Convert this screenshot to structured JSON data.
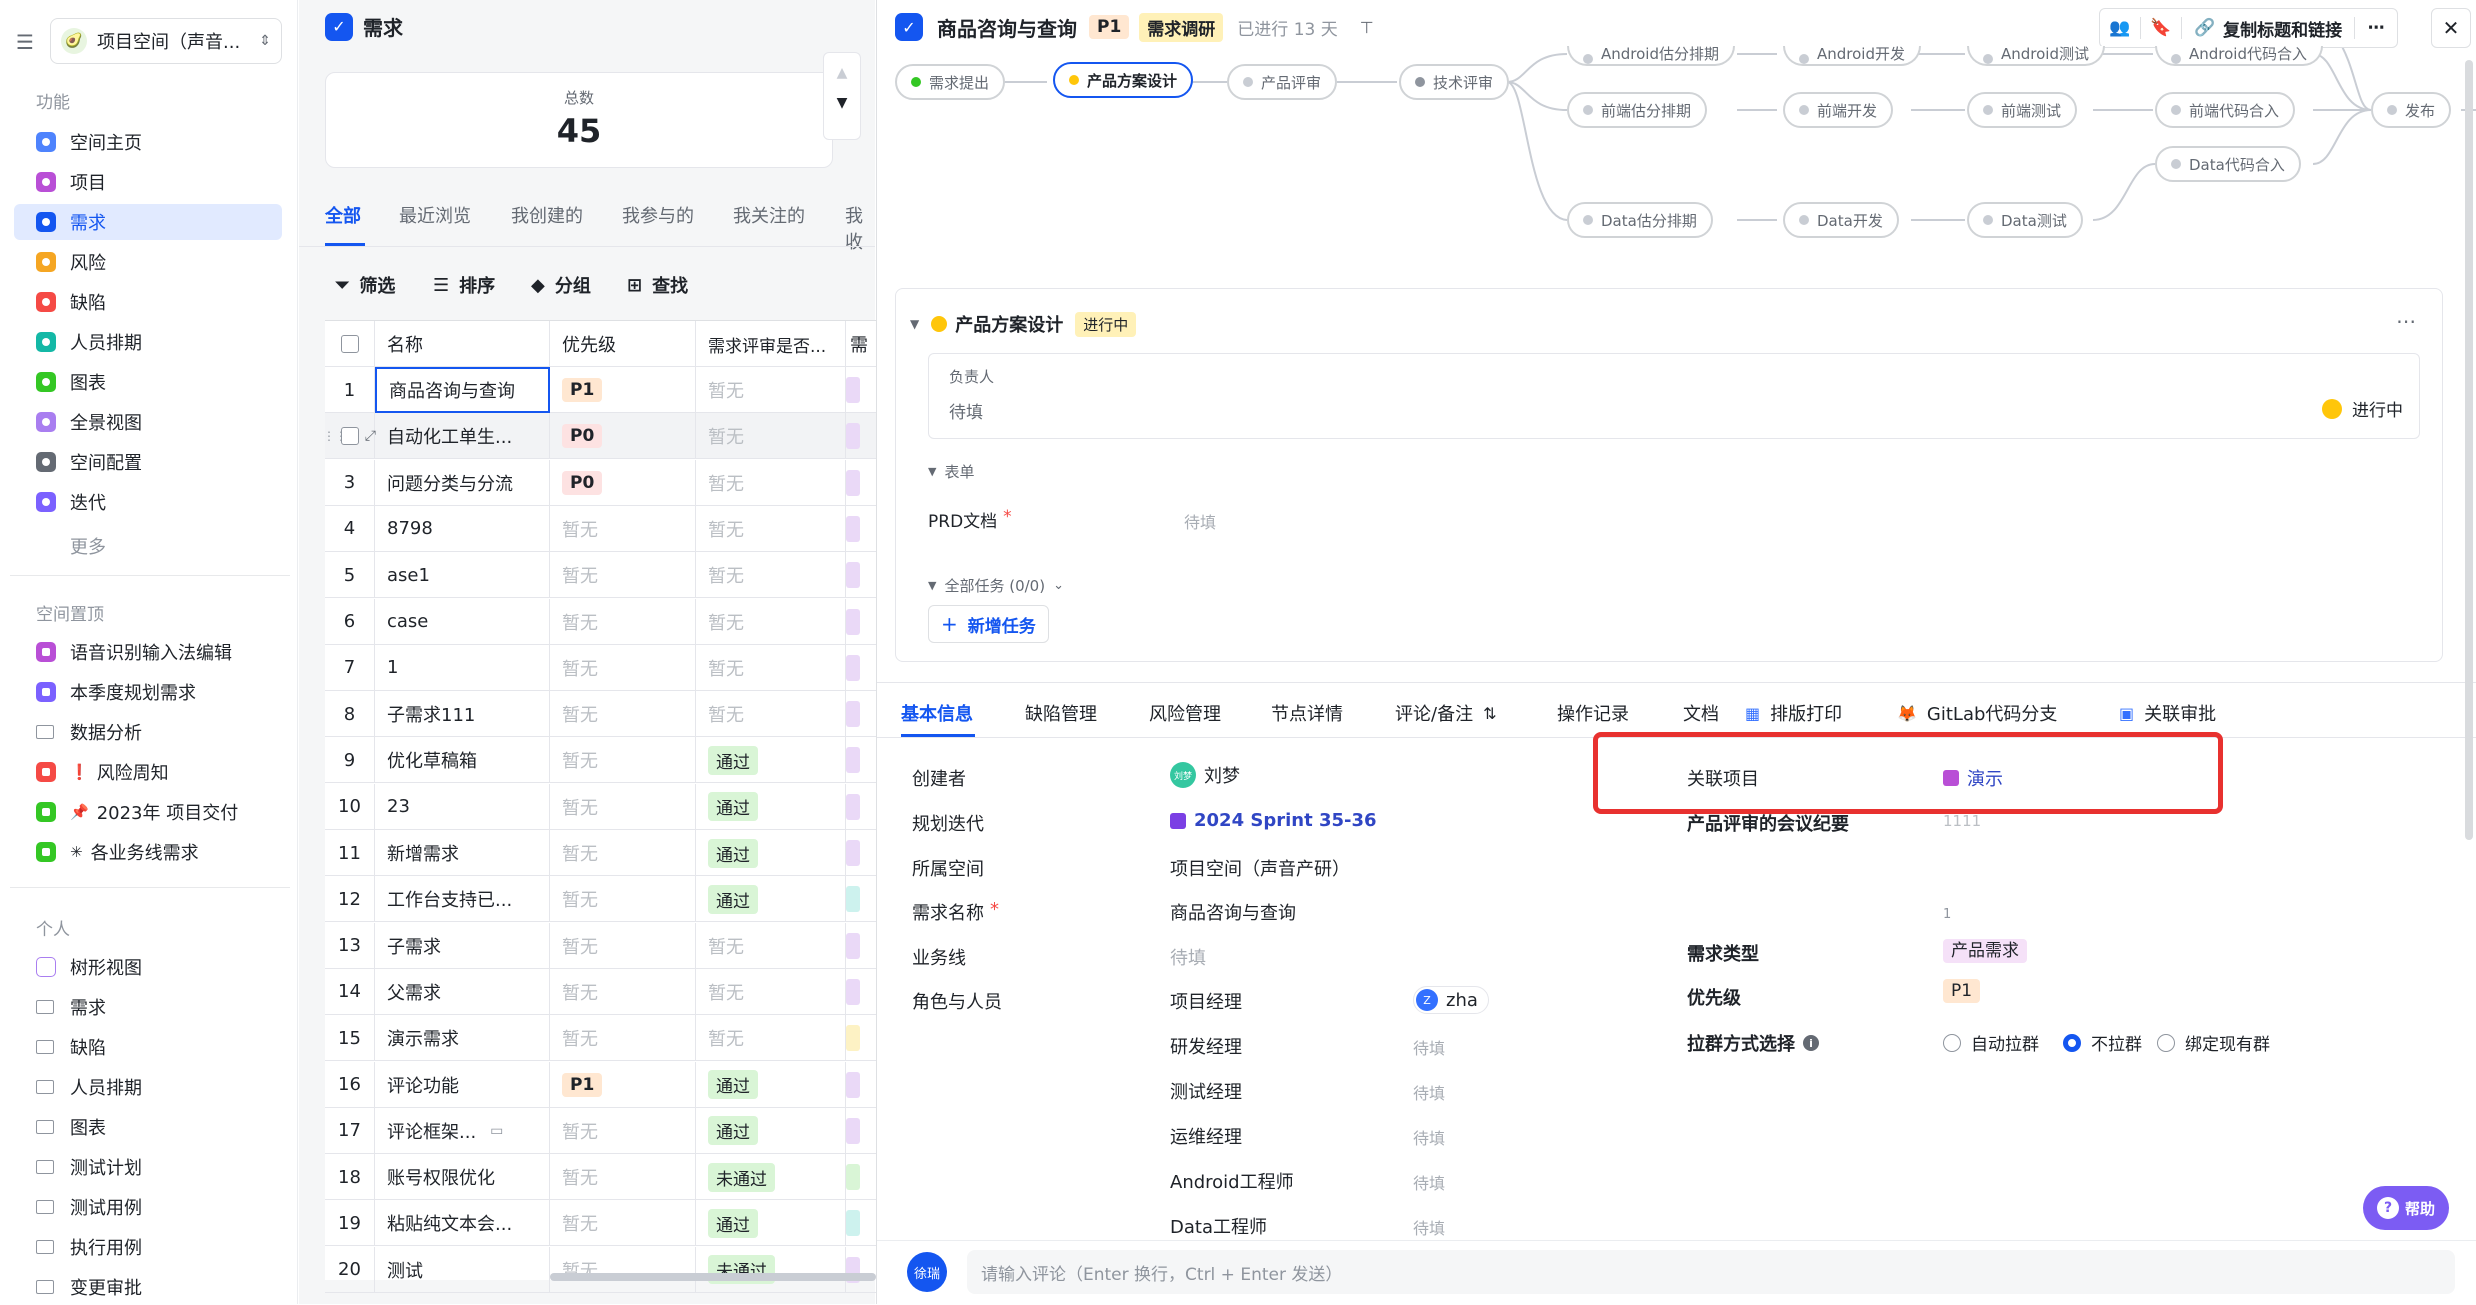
{
  "sidebar": {
    "space_name": "项目空间（声音...",
    "section_features": "功能",
    "features": [
      {
        "label": "空间主页",
        "color": "#4e83fd"
      },
      {
        "label": "项目",
        "color": "#b94fd6"
      },
      {
        "label": "需求",
        "color": "#1456f0"
      },
      {
        "label": "风险",
        "color": "#f5a623"
      },
      {
        "label": "缺陷",
        "color": "#f54a45"
      },
      {
        "label": "人员排期",
        "color": "#14b8a6"
      },
      {
        "label": "图表",
        "color": "#34c724"
      },
      {
        "label": "全景视图",
        "color": "#a97ef0"
      },
      {
        "label": "空间配置",
        "color": "#646a73"
      },
      {
        "label": "迭代",
        "color": "#7b61ff"
      }
    ],
    "more": "更多",
    "section_pinned": "空间置顶",
    "pinned": [
      {
        "label": "语音识别输入法编辑",
        "color": "#b94fd6"
      },
      {
        "label": "本季度规划需求",
        "color": "#7b61ff"
      },
      {
        "label": "数据分析",
        "color": "#8f959e"
      },
      {
        "label": "风险周知",
        "color": "#f54a45",
        "prefix": "❗"
      },
      {
        "label": "2023年 项目交付",
        "color": "#34c724",
        "prefix": "📌"
      },
      {
        "label": "各业务线需求",
        "color": "#34c724",
        "prefix": "✳"
      }
    ],
    "section_personal": "个人",
    "personal": [
      "树形视图",
      "需求",
      "缺陷",
      "人员排期",
      "图表",
      "测试计划",
      "测试用例",
      "执行用例",
      "变更审批"
    ]
  },
  "middle": {
    "title": "需求",
    "total_label": "总数",
    "total_value": "45",
    "tabs": [
      "全部",
      "最近浏览",
      "我创建的",
      "我参与的",
      "我关注的",
      "我收"
    ],
    "toolbar": [
      "筛选",
      "排序",
      "分组",
      "查找"
    ],
    "columns": [
      "名称",
      "优先级",
      "需求评审是否..."
    ],
    "rows": [
      {
        "n": "1",
        "name": "商品咨询与查询",
        "pri": "P1",
        "rev": "暂无",
        "ext": "purple"
      },
      {
        "n": "",
        "name": "自动化工单生...",
        "pri": "P0",
        "rev": "暂无",
        "ext": "purple"
      },
      {
        "n": "3",
        "name": "问题分类与分流",
        "pri": "P0",
        "rev": "暂无",
        "ext": "purple"
      },
      {
        "n": "4",
        "name": "8798",
        "pri": "暂无",
        "rev": "暂无",
        "ext": "purple"
      },
      {
        "n": "5",
        "name": "ase1",
        "pri": "暂无",
        "rev": "暂无",
        "ext": "purple"
      },
      {
        "n": "6",
        "name": "case",
        "pri": "暂无",
        "rev": "暂无",
        "ext": "purple"
      },
      {
        "n": "7",
        "name": "1",
        "pri": "暂无",
        "rev": "暂无",
        "ext": "purple"
      },
      {
        "n": "8",
        "name": "子需求111",
        "pri": "暂无",
        "rev": "暂无",
        "ext": "purple"
      },
      {
        "n": "9",
        "name": "优化草稿箱",
        "pri": "暂无",
        "rev": "通过",
        "ext": "purple"
      },
      {
        "n": "10",
        "name": "23",
        "pri": "暂无",
        "rev": "通过",
        "ext": "purple"
      },
      {
        "n": "11",
        "name": "新增需求",
        "pri": "暂无",
        "rev": "通过",
        "ext": "purple"
      },
      {
        "n": "12",
        "name": "工作台支持已...",
        "pri": "暂无",
        "rev": "通过",
        "ext": "teal"
      },
      {
        "n": "13",
        "name": "子需求",
        "pri": "暂无",
        "rev": "暂无",
        "ext": "purple"
      },
      {
        "n": "14",
        "name": "父需求",
        "pri": "暂无",
        "rev": "暂无",
        "ext": "purple"
      },
      {
        "n": "15",
        "name": "演示需求",
        "pri": "暂无",
        "rev": "暂无",
        "ext": "yellow"
      },
      {
        "n": "16",
        "name": "评论功能",
        "pri": "P1",
        "rev": "通过",
        "ext": "purple"
      },
      {
        "n": "17",
        "name": "评论框架...",
        "pri": "暂无",
        "rev": "通过",
        "ext": "purple"
      },
      {
        "n": "18",
        "name": "账号权限优化",
        "pri": "暂无",
        "rev": "未通过",
        "ext": "green"
      },
      {
        "n": "19",
        "name": "粘贴纯文本会...",
        "pri": "暂无",
        "rev": "通过",
        "ext": "teal"
      },
      {
        "n": "20",
        "name": "测试",
        "pri": "暂无",
        "rev": "未通过",
        "ext": "purple"
      }
    ]
  },
  "panel": {
    "title": "商品咨询与查询",
    "priority": "P1",
    "stage": "需求调研",
    "elapsed": "已进行 13 天",
    "copy_btn": "复制标题和链接",
    "flow": {
      "main": [
        "需求提出",
        "产品方案设计",
        "产品评审",
        "技术评审"
      ],
      "top": [
        "Android估分排期",
        "Android开发",
        "Android测试",
        "Android代码合入"
      ],
      "front": [
        "前端估分排期",
        "前端开发",
        "前端测试",
        "前端代码合入"
      ],
      "data_merge": "Data代码合入",
      "data": [
        "Data估分排期",
        "Data开发",
        "Data测试"
      ],
      "release": "发布"
    },
    "node": {
      "name": "产品方案设计",
      "status": "进行中",
      "owner_label": "负责人",
      "owner_value": "待填",
      "owner_status": "进行中",
      "form_label": "表单",
      "prd_label": "PRD文档",
      "prd_value": "待填",
      "tasks_label": "全部任务 (0/0)",
      "add_task": "新增任务"
    },
    "tabs": [
      "基本信息",
      "缺陷管理",
      "风险管理",
      "节点详情",
      "评论/备注",
      "操作记录",
      "文档",
      "排版打印",
      "GitLab代码分支",
      "关联审批"
    ],
    "info": {
      "creator_label": "创建者",
      "creator_avatar": "刘梦",
      "creator": "刘梦",
      "iteration_label": "规划迭代",
      "iteration": "2024 Sprint 35-36",
      "space_label": "所属空间",
      "space": "项目空间（声音产研）",
      "name_label": "需求名称",
      "name": "商品咨询与查询",
      "line_label": "业务线",
      "line": "待填",
      "roles_label": "角色与人员",
      "roles": [
        {
          "role": "项目经理",
          "value": "zha",
          "avatar": "Z"
        },
        {
          "role": "研发经理",
          "value": "待填"
        },
        {
          "role": "测试经理",
          "value": "待填"
        },
        {
          "role": "运维经理",
          "value": "待填"
        },
        {
          "role": "Android工程师",
          "value": "待填"
        },
        {
          "role": "Data工程师",
          "value": "待填"
        }
      ],
      "linked_label": "关联项目",
      "linked": "演示",
      "minutes_label": "产品评审的会议纪要",
      "minutes": "1111",
      "minutes_extra": "1",
      "type_label": "需求类型",
      "type": "产品需求",
      "pri_label": "优先级",
      "pri": "P1",
      "group_label": "拉群方式选择",
      "group_options": [
        "自动拉群",
        "不拉群",
        "绑定现有群"
      ],
      "group_selected": 1
    },
    "comment_avatar": "徐瑞",
    "comment_placeholder": "请输入评论（Enter 换行，Ctrl + Enter 发送）",
    "help": "帮助"
  }
}
